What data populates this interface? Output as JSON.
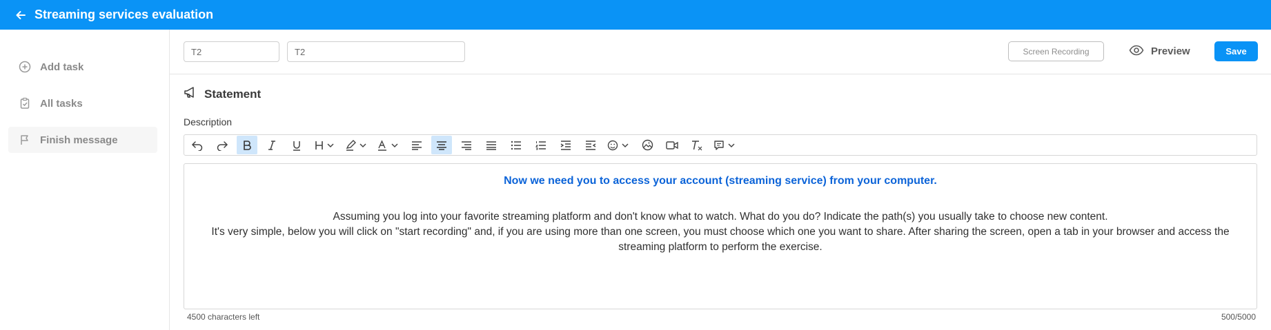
{
  "header": {
    "title": "Streaming services evaluation"
  },
  "sidebar": {
    "items": [
      {
        "label": "Add task",
        "icon": "plus-circle-icon"
      },
      {
        "label": "All tasks",
        "icon": "clipboard-check-icon"
      },
      {
        "label": "Finish message",
        "icon": "flag-icon"
      }
    ]
  },
  "toolbar": {
    "input1_value": "T2",
    "input2_value": "T2",
    "screen_recording_label": "Screen Recording",
    "preview_label": "Preview",
    "save_label": "Save"
  },
  "section": {
    "title": "Statement",
    "description_label": "Description"
  },
  "editor": {
    "headline": "Now we need you to access your account (streaming service) from your computer.",
    "paragraph1": "Assuming you log into your favorite streaming platform and don't know what to watch. What do you do? Indicate the path(s) you usually take to choose new content.",
    "paragraph2": "It's very simple, below you will click on \"start recording\" and, if you are using more than one screen, you must choose which one you want to share. After sharing the screen, open a tab in your browser and access the streaming platform to perform the exercise.",
    "chars_left": "4500 characters left",
    "char_count": "500/5000"
  },
  "colors": {
    "brand": "#0a93f6",
    "headline": "#0b63d8",
    "active_tool": "#cfe6fb"
  }
}
